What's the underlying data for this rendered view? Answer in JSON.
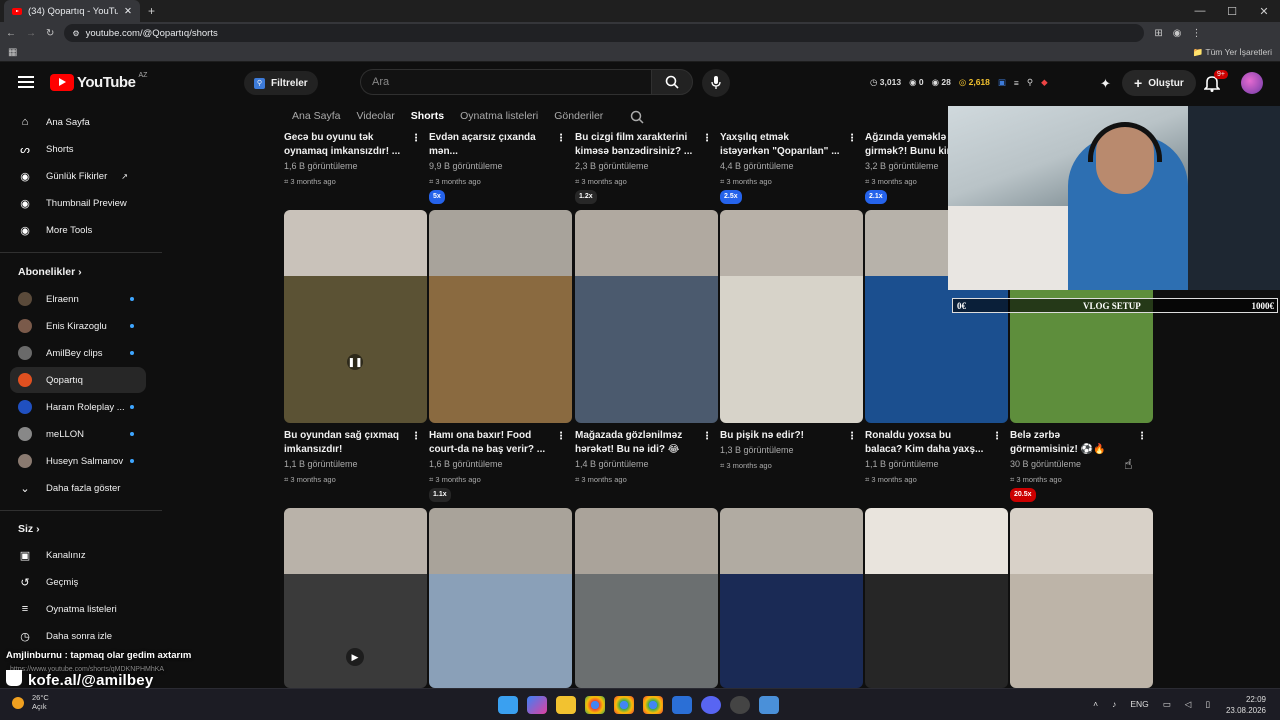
{
  "browser": {
    "tab_title": "(34) Qopartıq - YouTube",
    "new_tab": "+",
    "url": "youtube.com/@Qopartıq/shorts",
    "bookmarks_label": "Tüm Yer İşaretleri",
    "win_min": "—",
    "win_max": "☐",
    "win_close": "✕"
  },
  "header": {
    "logo_text": "YouTube",
    "logo_region": "AZ",
    "filters_label": "Filtreler",
    "search_placeholder": "Ara",
    "create_label": "Oluştur",
    "notifications_badge": "9+",
    "stats": [
      {
        "icon": "clock-icon",
        "value": "3,013"
      },
      {
        "icon": "eye-icon",
        "value": "0"
      },
      {
        "icon": "eye-icon",
        "value": "28"
      },
      {
        "icon": "coin-icon",
        "value": "2,618"
      }
    ]
  },
  "sidebar": {
    "main": [
      {
        "label": "Ana Sayfa",
        "icon": "home-icon"
      },
      {
        "label": "Shorts",
        "icon": "shorts-icon"
      },
      {
        "label": "Günlük Fikirler",
        "icon": "ideas-icon"
      },
      {
        "label": "Thumbnail Preview",
        "icon": "preview-icon"
      },
      {
        "label": "More Tools",
        "icon": "tools-icon"
      }
    ],
    "subs_heading": "Abonelikler",
    "subs": [
      {
        "label": "Elraenn",
        "color": "#5a4a3a"
      },
      {
        "label": "Enis Kirazoglu",
        "color": "#7a5a4a"
      },
      {
        "label": "AmilBey clips",
        "color": "#6a6a6a"
      },
      {
        "label": "Qopartıq",
        "color": "#e05020"
      },
      {
        "label": "Haram Roleplay ...",
        "color": "#2050c0"
      },
      {
        "label": "meLLON",
        "color": "#888888"
      },
      {
        "label": "Huseyn Salmanov",
        "color": "#8a7a70"
      }
    ],
    "show_more": "Daha fazla göster",
    "you_heading": "Siz",
    "you": [
      {
        "label": "Kanalınız",
        "icon": "channel-icon"
      },
      {
        "label": "Geçmiş",
        "icon": "history-icon"
      },
      {
        "label": "Oynatma listeleri",
        "icon": "playlists-icon"
      },
      {
        "label": "Daha sonra izle",
        "icon": "watch-later-icon"
      }
    ]
  },
  "channel_tabs": [
    "Ana Sayfa",
    "Videolar",
    "Shorts",
    "Oynatma listeleri",
    "Gönderiler"
  ],
  "row1": [
    {
      "title1": "Gecə bu oyunu tək",
      "title2": "oynamaq imkansızdır! ...",
      "views": "1,6 B görüntüleme",
      "ago": "3 months ago",
      "speed": ""
    },
    {
      "title1": "Evdən açarsız çıxanda",
      "title2": "mən...",
      "views": "9,9 B görüntüleme",
      "ago": "3 months ago",
      "speed": "5x"
    },
    {
      "title1": "Bu cizgi film xarakterini",
      "title2": "kiməsə bənzədirsiniz? ...",
      "views": "2,3 B görüntüleme",
      "ago": "3 months ago",
      "speed": "1.2x"
    },
    {
      "title1": "Yaxşılıq etmək",
      "title2": "istəyərkən \"Qoparılan\" ...",
      "views": "4,4 B görüntüleme",
      "ago": "3 months ago",
      "speed": "2.5x"
    },
    {
      "title1": "Ağzında yeməklə",
      "title2": "girmək?! Bunu kim...",
      "views": "3,2 B görüntüleme",
      "ago": "3 months ago",
      "speed": "2.1x"
    }
  ],
  "row2": [
    {
      "title1": "Bu oyundan sağ çıxmaq",
      "title2": "imkansızdır!",
      "views": "1,1 B görüntüleme",
      "ago": "3 months ago",
      "speed": ""
    },
    {
      "title1": "Hamı ona baxır! Food",
      "title2": "court-da nə baş verir? ...",
      "views": "1,6 B görüntüleme",
      "ago": "3 months ago",
      "speed": "1.1x"
    },
    {
      "title1": "Mağazada gözlənilməz",
      "title2": "hərəkət! Bu nə idi? 😂",
      "views": "1,4 B görüntüleme",
      "ago": "3 months ago",
      "speed": ""
    },
    {
      "title1": "Bu pişik nə edir?!",
      "title2": "",
      "views": "1,3 B görüntüleme",
      "ago": "3 months ago",
      "speed": ""
    },
    {
      "title1": "Ronaldu yoxsa bu",
      "title2": "balaca? Kim daha yaxş...",
      "views": "1,1 B görüntüleme",
      "ago": "3 months ago",
      "speed": ""
    },
    {
      "title1": "Belə zərbə",
      "title2": "görməmisiniz! ⚽🔥",
      "views": "30 B görüntüleme",
      "ago": "3 months ago",
      "speed": "20.5x"
    }
  ],
  "row2_thumbs": [
    {
      "face": "#c9c2ba",
      "clip": "#5b5234"
    },
    {
      "face": "#a8a39b",
      "clip": "#8a6a40"
    },
    {
      "face": "#b0a9a0",
      "clip": "#4b5a6e"
    },
    {
      "face": "#b8b1a8",
      "clip": "#d7d3c9"
    },
    {
      "face": "#b7b2aa",
      "clip": "#1b4f8f"
    },
    {
      "face": "#7a6f60",
      "clip": "#5e8e3c"
    }
  ],
  "row3_thumbs": [
    {
      "face": "#b9b2a9",
      "clip": "#3a3a3a"
    },
    {
      "face": "#a9a39a",
      "clip": "#8aa0b8"
    },
    {
      "face": "#aaa39a",
      "clip": "#6b6f70"
    },
    {
      "face": "#b1aba2",
      "clip": "#1a2a55"
    },
    {
      "face": "#e9e4dd",
      "clip": "#262626"
    },
    {
      "face": "#d8d1c8",
      "clip": "#bdb4a8"
    }
  ],
  "overlay": {
    "vlog_left": "0€",
    "vlog_center": "VLOG SETUP",
    "vlog_right": "1000€",
    "chat_line": "Amjlinburnu : tapmaq olar gedim axtarım",
    "chat_sub": "https://www.youtube.com/shorts/qMDKNPHMhKA",
    "kofe": "kofe.al/@amilbey"
  },
  "taskbar": {
    "temp": "26°C",
    "weather": "Açık",
    "lang": "ENG",
    "time": "22:09",
    "date": "23.08.2026"
  },
  "colors": {
    "accent": "#ff0000",
    "speed_badge": "#2563eb",
    "sub_dot": "#3ea6ff"
  }
}
